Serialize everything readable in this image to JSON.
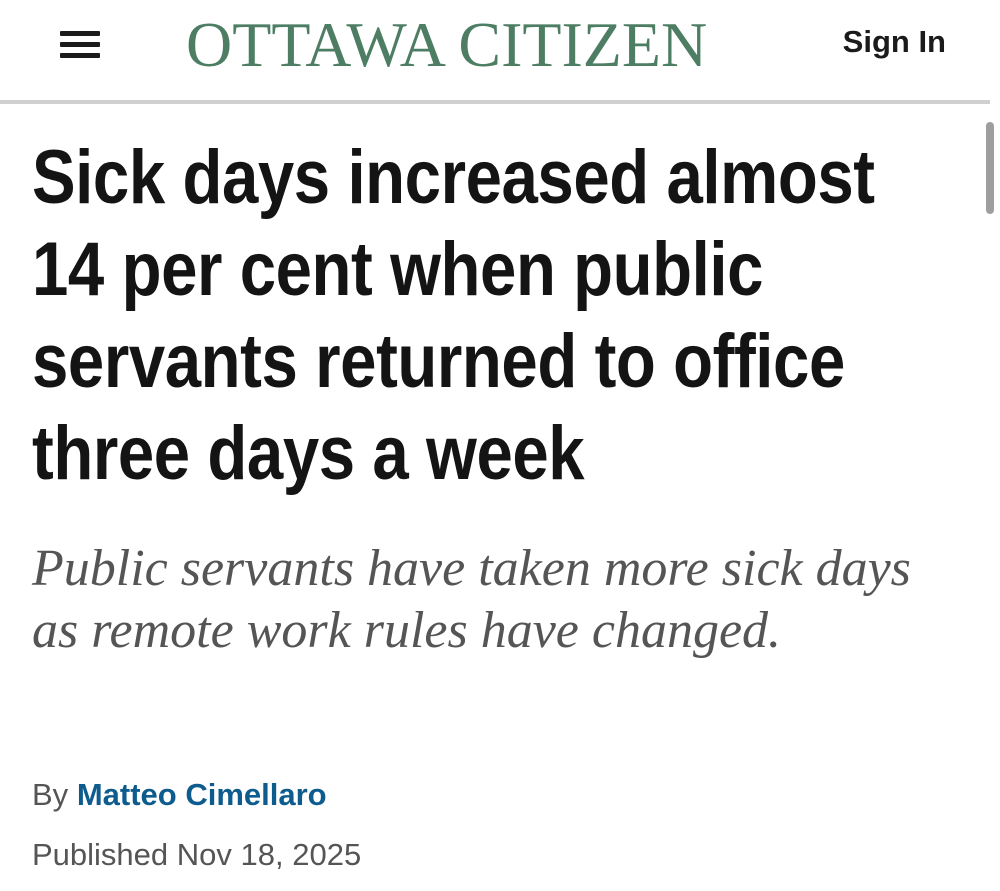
{
  "header": {
    "menu_icon": "hamburger-menu-icon",
    "logo": "OTTAWA CITIZEN",
    "sign_in_label": "Sign In",
    "logo_color": "#4d7d63"
  },
  "article": {
    "headline": "Sick days increased almost 14 per cent when public servants returned to office three days a week",
    "deck": "Public servants have taken more sick days as remote work rules have changed.",
    "byline_prefix": "By",
    "author": "Matteo Cimellaro",
    "published": "Published Nov 18, 2025",
    "author_color": "#0e5c8e"
  }
}
